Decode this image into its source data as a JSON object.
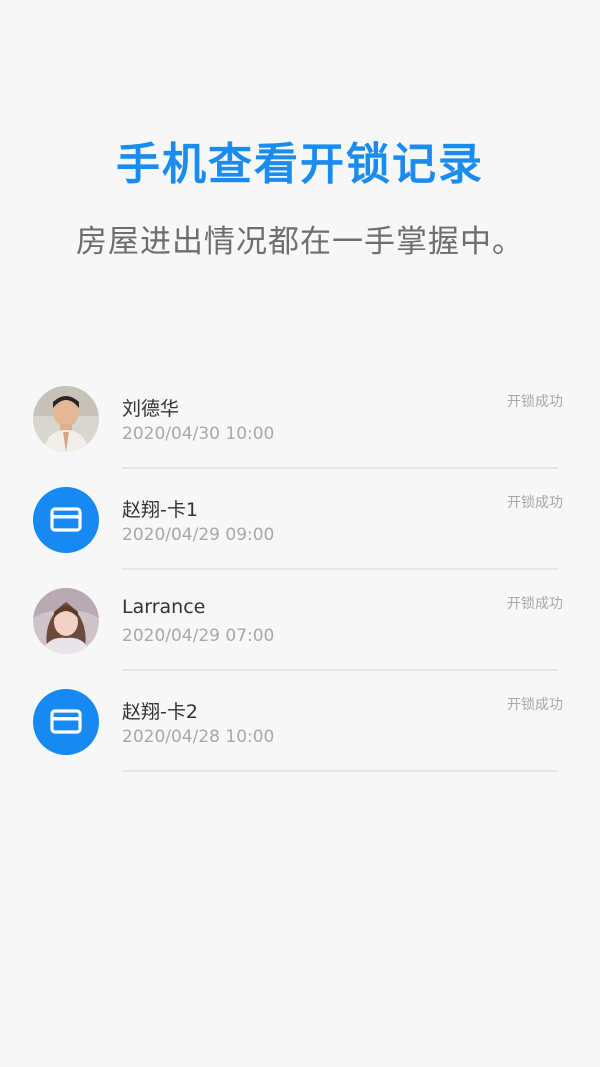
{
  "header": {
    "title": "手机查看开锁记录",
    "subtitle": "房屋进出情况都在一手掌握中。"
  },
  "colors": {
    "accent": "#1a8cf0",
    "card_icon_bg": "#1689f2"
  },
  "records": [
    {
      "name": "刘德华",
      "time": "2020/04/30 10:00",
      "status": "开锁成功",
      "avatar": "person-photo-male"
    },
    {
      "name": "赵翔-卡1",
      "time": "2020/04/29 09:00",
      "status": "开锁成功",
      "avatar": "card-icon"
    },
    {
      "name": "Larrance",
      "time": "2020/04/29 07:00",
      "status": "开锁成功",
      "avatar": "person-photo-female"
    },
    {
      "name": "赵翔-卡2",
      "time": "2020/04/28 10:00",
      "status": "开锁成功",
      "avatar": "card-icon"
    }
  ]
}
